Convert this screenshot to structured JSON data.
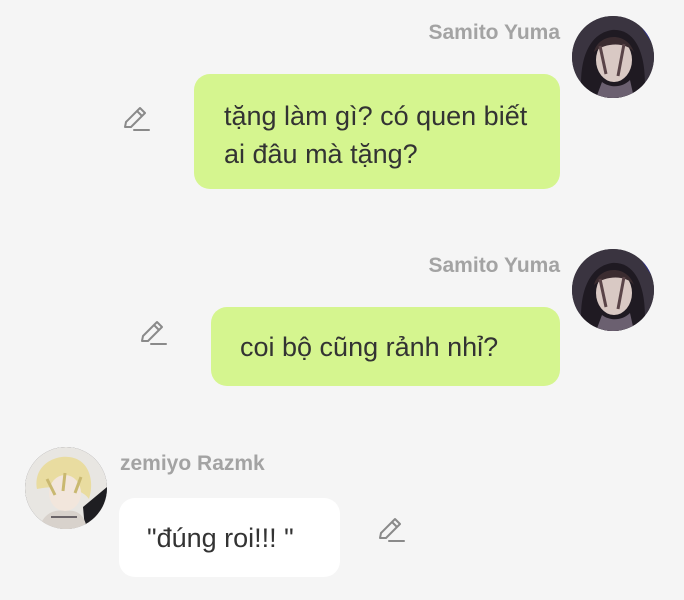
{
  "messages": [
    {
      "sender": "Samito Yuma",
      "side": "right",
      "text": "tặng làm gì? có quen biết ai đâu mà tặng?",
      "avatar_icon": "user-avatar-dark-hair",
      "edit_icon": "pencil-edit-icon"
    },
    {
      "sender": "Samito Yuma",
      "side": "right",
      "text": "coi bộ cũng rảnh nhỉ?",
      "avatar_icon": "user-avatar-dark-hair",
      "edit_icon": "pencil-edit-icon"
    },
    {
      "sender": "zemiyo Razmk",
      "side": "left",
      "text": "\"đúng roi!!! \"",
      "avatar_icon": "user-avatar-blond-hair",
      "edit_icon": "pencil-edit-icon"
    }
  ],
  "colors": {
    "background": "#f5f5f5",
    "sent_bubble": "#d5f58f",
    "received_bubble": "#ffffff",
    "sender_name": "#a3a3a3",
    "message_text": "#333333",
    "icon": "#8a8a8a"
  }
}
